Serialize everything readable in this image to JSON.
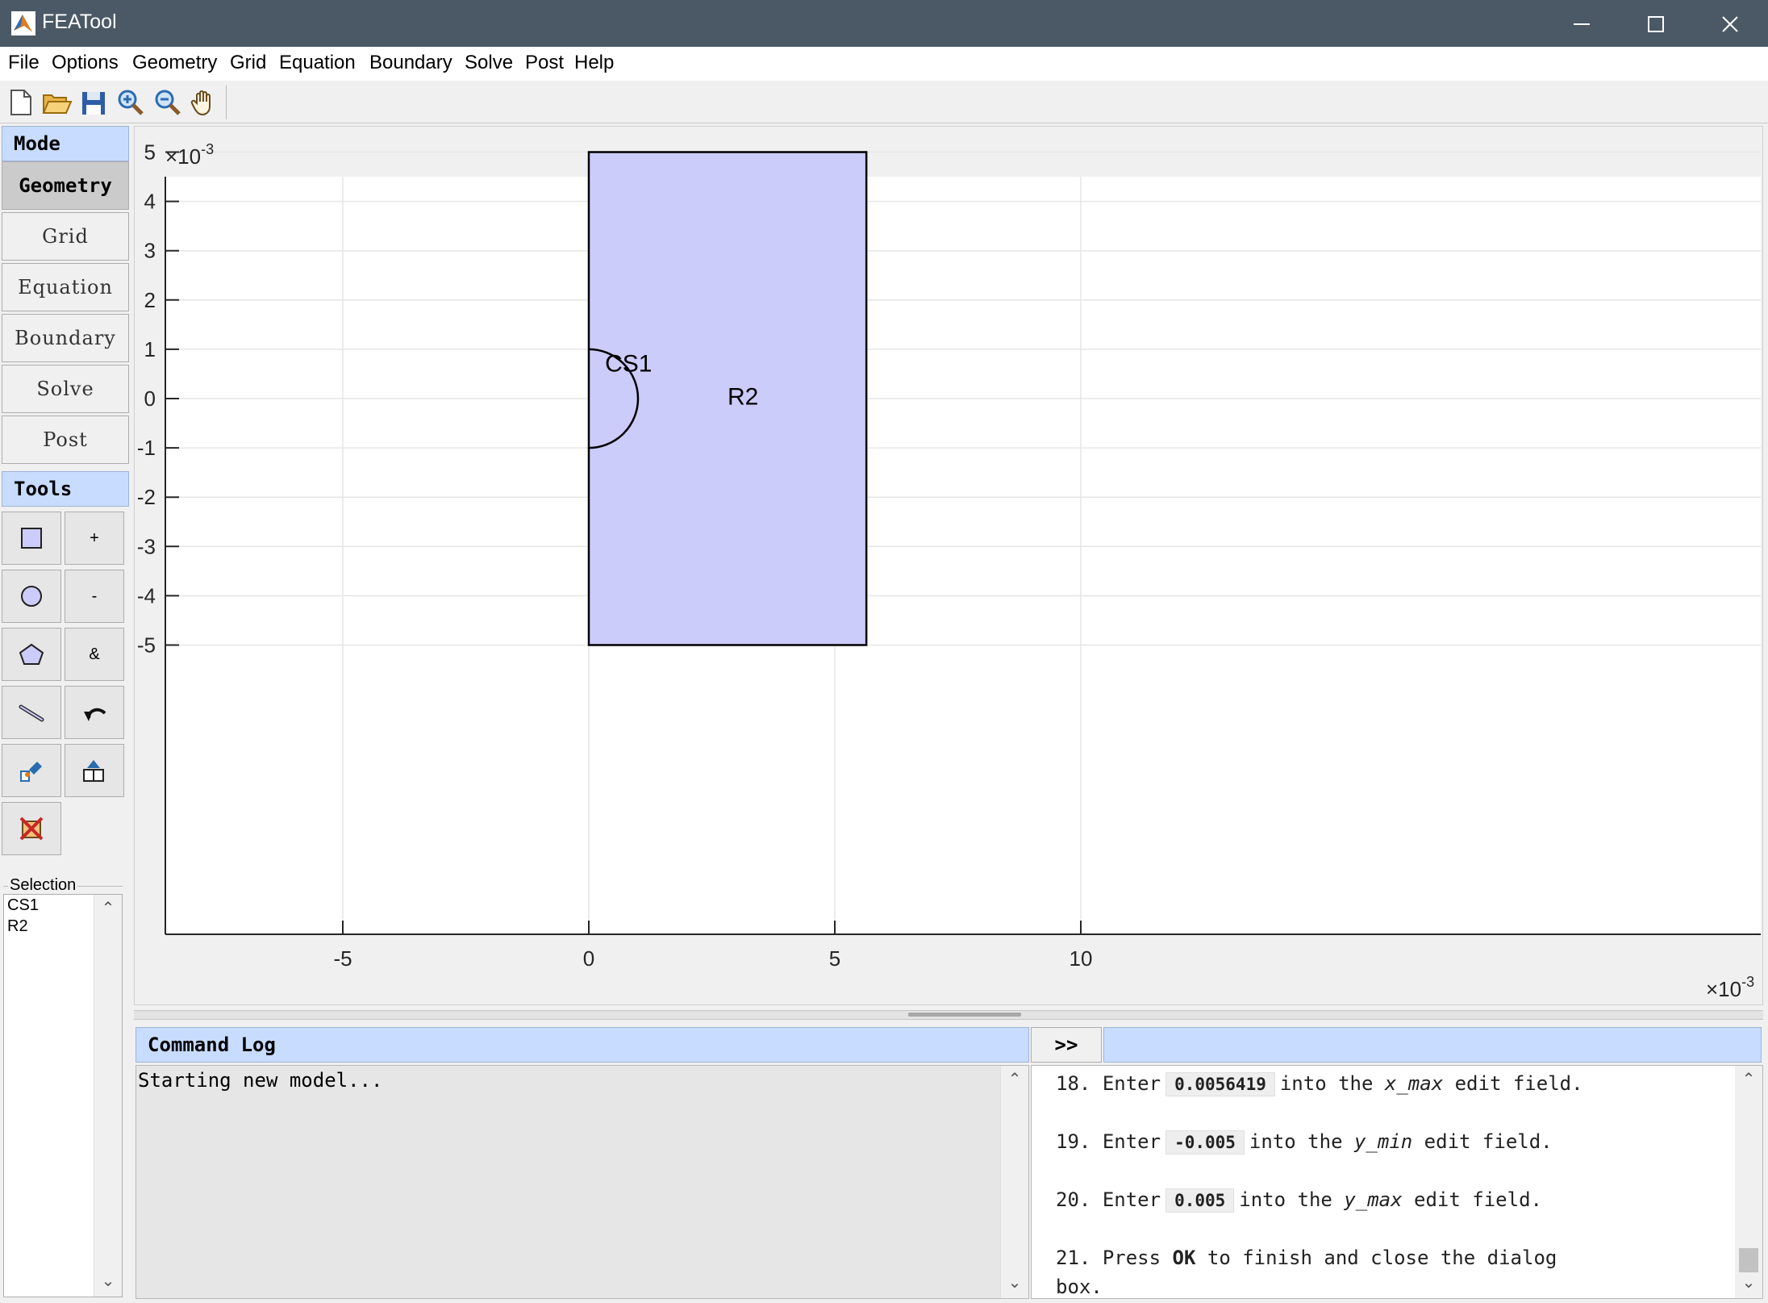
{
  "window": {
    "title": "FEATool"
  },
  "menu": [
    "File",
    "Options",
    "Geometry",
    "Grid",
    "Equation",
    "Boundary",
    "Solve",
    "Post",
    "Help"
  ],
  "toolbar": {
    "icons": [
      "new-file-icon",
      "open-folder-icon",
      "save-icon",
      "zoom-in-icon",
      "zoom-out-icon",
      "pan-hand-icon"
    ]
  },
  "left_panel": {
    "mode_header": "Mode",
    "modes": [
      "Geometry",
      "Grid",
      "Equation",
      "Boundary",
      "Solve",
      "Post"
    ],
    "active_mode": "Geometry",
    "tools_header": "Tools",
    "tools": [
      {
        "name": "rectangle-icon",
        "label": ""
      },
      {
        "name": "plus-union",
        "label": "+"
      },
      {
        "name": "circle-icon",
        "label": ""
      },
      {
        "name": "minus-subtract",
        "label": "-"
      },
      {
        "name": "polygon-icon",
        "label": ""
      },
      {
        "name": "ampersand-intersect",
        "label": "&"
      },
      {
        "name": "line-edit-icon",
        "label": ""
      },
      {
        "name": "undo-arrow-icon",
        "label": ""
      },
      {
        "name": "object-tool-icon",
        "label": ""
      },
      {
        "name": "scale-tool-icon",
        "label": ""
      },
      {
        "name": "delete-geometry-icon",
        "label": ""
      }
    ],
    "selection_label": "Selection",
    "selection_items": [
      "CS1",
      "R2"
    ]
  },
  "plot": {
    "exponent_label_y": "×10",
    "exponent_label_x": "×10",
    "exponent": "-3",
    "x_ticks": [
      "-5",
      "0",
      "5",
      "10"
    ],
    "y_ticks": [
      "5",
      "4",
      "3",
      "2",
      "1",
      "0",
      "-1",
      "-2",
      "-3",
      "-4",
      "-5"
    ],
    "objects": [
      {
        "tag": "R2",
        "type": "rectangle",
        "x_min": 0,
        "x_max": 0.0056419,
        "y_min": -0.005,
        "y_max": 0.005
      },
      {
        "tag": "CS1",
        "type": "half-circle",
        "cx": 0,
        "cy": 0,
        "r": 0.001
      }
    ],
    "fill_color": "#ccccfa"
  },
  "command_log": {
    "title": "Command Log",
    "expand_label": ">>",
    "text": "Starting new model..."
  },
  "help_steps": [
    {
      "num": "18.",
      "pre": "Enter",
      "code": "0.0056419",
      "mid": "into the",
      "var": "x_max",
      "post": "edit field."
    },
    {
      "num": "19.",
      "pre": "Enter",
      "code": "-0.005",
      "mid": "into the",
      "var": "y_min",
      "post": "edit field."
    },
    {
      "num": "20.",
      "pre": "Enter",
      "code": "0.005",
      "mid": "into the",
      "var": "y_max",
      "post": "edit field."
    }
  ],
  "help_step_21": {
    "num": "21.",
    "pre": "Press",
    "bold": "OK",
    "post": "to finish and close the dialog",
    "wrap": "box."
  }
}
